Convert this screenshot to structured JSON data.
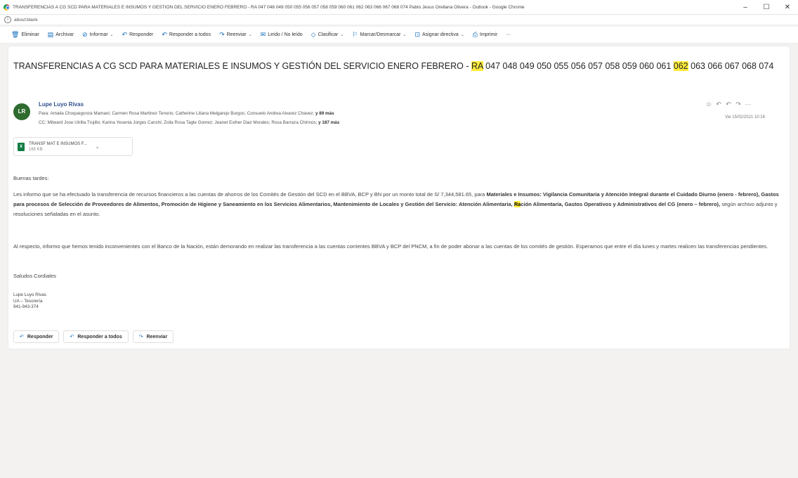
{
  "window": {
    "title": "TRANSFERENCIAS A CG SCD PARA MATERIALES E INSUMOS Y GESTIÓN DEL SERVICIO ENERO FEBRERO - RA 047 048 049 050 055 056 057 058 059 060 061 062 063 066 067 068 074 Pablo Jesus Orellana Olivera - Outlook - Google Chrome",
    "controls": [
      "–",
      "☐",
      "✕"
    ]
  },
  "address": {
    "url": "about:blank"
  },
  "toolbar": {
    "items": [
      {
        "label": "Eliminar",
        "icon": "🗑"
      },
      {
        "label": "Archivar",
        "icon": "▤"
      },
      {
        "label": "Informar",
        "icon": "⊘",
        "dropdown": true
      },
      {
        "label": "Responder",
        "icon": "↶"
      },
      {
        "label": "Responder a todos",
        "icon": "↶"
      },
      {
        "label": "Reenviar",
        "icon": "↷",
        "dropdown": true
      },
      {
        "label": "Leído / No leído",
        "icon": "✉"
      },
      {
        "label": "Clasificar",
        "icon": "◇",
        "dropdown": true
      },
      {
        "label": "Marcar/Desmarcar",
        "icon": "⚐",
        "dropdown": true
      },
      {
        "label": "Asignar directiva",
        "icon": "⊡",
        "dropdown": true
      },
      {
        "label": "Imprimir",
        "icon": "⎙"
      },
      {
        "label": "···",
        "icon": ""
      }
    ]
  },
  "message": {
    "subject": {
      "prefix": "TRANSFERENCIAS A CG SCD PARA MATERIALES E INSUMOS Y GESTIÓN DEL SERVICIO ENERO FEBRERO - ",
      "hl1": "RA",
      "mid": " 047 048 049 050 055 056 057 058 059 060 061 ",
      "hl2": "062",
      "suffix": " 063 066 067 068 074"
    },
    "sender": {
      "initials": "LR",
      "name": "Lupe Luyo Rivas"
    },
    "to": {
      "label": "Para:",
      "names": "Amalia Choquegonza Mamani; Carmen Rosa Martinez Tenorio; Catherine Liliana Melgarejo Burgos; Consuelo Andrea Alvarez Chavez;",
      "more": "y 89 más"
    },
    "cc": {
      "label": "CC:",
      "names": "Milward Jose Utrilla Trujillo; Karina Yesenia Jorges Canchi; Zoila Rosa Tagle Gomez; Jeanet Esther Diaz Morales; Rosa Barraza Chirinos;",
      "more": "y 187 más"
    },
    "date": "Vie 15/02/2021 10:16",
    "actions": [
      "☺",
      "↶",
      "↶",
      "↷",
      "···"
    ],
    "attachment": {
      "name": "TRANSF MAT E INSUMOS F...",
      "size": "165 KB"
    },
    "greeting": "Buenas tardes:",
    "p1": {
      "a": "Les informo que se ha efectuado la transferencia de recursos financieros a las cuentas de ahorros de los Comités de Gestión del SCD en el BBVA, BCP y BN por un monto total de S/ 7,344,581.65, para ",
      "b1": "Materiales e Insumos: Vigilancia Comunitaria y Atención Integral durante el Cuidado Diurno (enero - febrero), Gastos para procesos de Selección de Proveedores de Alimentos, Promoción de Higiene y Saneamiento en los Servicios Alimentarios, Mantenimiento de Locales y Gestión del Servicio: Atención Alimentaria, ",
      "hl": "Ra",
      "b2": "ción Alimentaria, Gastos Operativos y Administrativos del CG (enero – febrero),",
      "c": " según archivo adjunto y resoluciones señaladas en el asunto."
    },
    "p2": "Al respecto, informo que hemos tenido inconvenientes con el Banco de la Nación, están demorando en realizar las transferencia a las cuentas corrientes BBVA y BCP del PNCM, a fin de poder abonar a las cuentas de los comités de gestión. Esperamos que entre el día lunes y martes realicen las transferencias pendientes.",
    "closing": "Saludos Cordiales",
    "signature": [
      "Lupe Luyo Rivas",
      "UA – Tesorería",
      "941-943-374"
    ],
    "reply_buttons": [
      {
        "label": "Responder",
        "icon": "↶"
      },
      {
        "label": "Responder a todos",
        "icon": "↶"
      },
      {
        "label": "Reenviar",
        "icon": "↷"
      }
    ]
  }
}
